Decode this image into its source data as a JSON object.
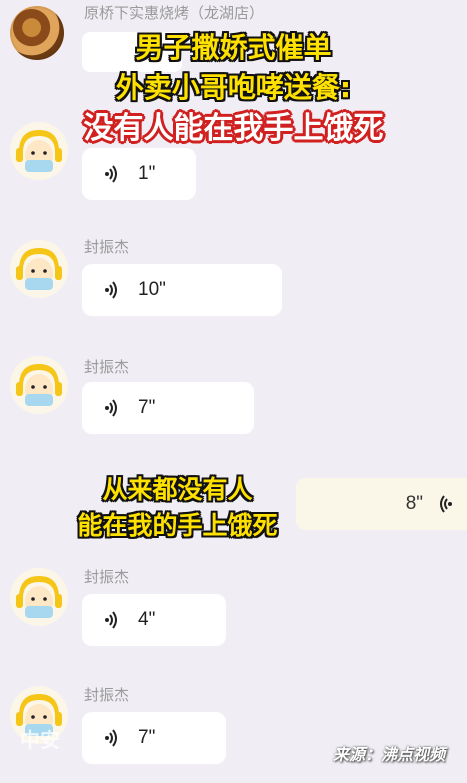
{
  "shop": {
    "name": "原桥下实惠烧烤（龙湖店）"
  },
  "messages": [
    {
      "sender": "",
      "duration": "1\""
    },
    {
      "sender": "封振杰",
      "duration": "10\""
    },
    {
      "sender": "封振杰",
      "duration": "7\""
    },
    {
      "sender": "封振杰",
      "duration": "4\""
    },
    {
      "sender": "封振杰",
      "duration": "7\""
    }
  ],
  "outgoing": {
    "duration": "8\""
  },
  "captions": {
    "headline_line1": "男子撒娇式催单",
    "headline_line2": "外卖小哥咆哮送餐:",
    "headline_line3": "没有人能在我手上饿死",
    "sub_line1": "从来都没有人",
    "sub_line2": "能在我的手上饿死"
  },
  "watermark": "来源：沸点视频",
  "logo_text": "中安",
  "colors": {
    "background": "#f0eef4",
    "caption_yellow": "#ffe100",
    "caption_red_outline": "#d02020"
  }
}
